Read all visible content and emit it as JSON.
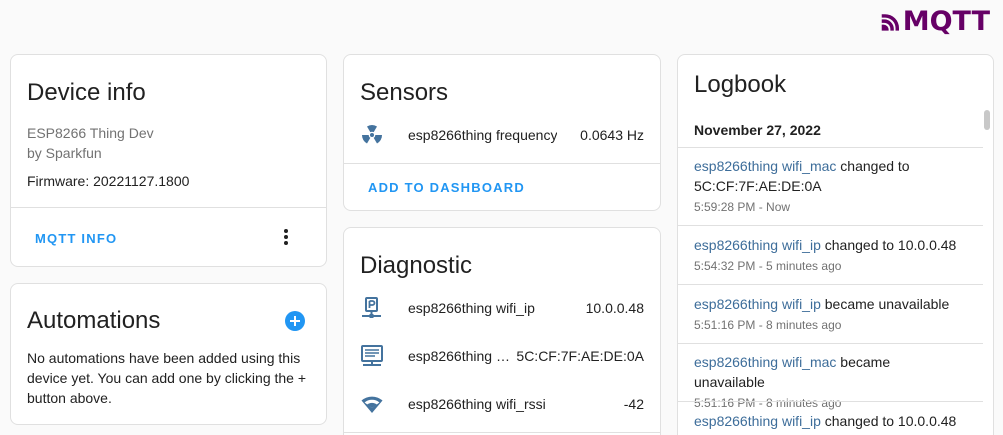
{
  "brand": {
    "logo_text": "MQTT",
    "logo_color": "#660066"
  },
  "device_info": {
    "title": "Device info",
    "model": "ESP8266 Thing Dev",
    "manufacturer": "by Sparkfun",
    "firmware": "Firmware: 20221127.1800",
    "action_label": "MQTT INFO",
    "menu_icon": "more-vert-icon"
  },
  "automations": {
    "title": "Automations",
    "add_icon": "plus-circle-icon",
    "empty_text": "No automations have been added using this device yet. You can add one by clicking the + button above."
  },
  "sensors": {
    "title": "Sensors",
    "items": [
      {
        "icon": "radioactive-icon",
        "name": "esp8266thing frequency",
        "value": "0.0643 Hz"
      }
    ],
    "action_label": "ADD TO DASHBOARD"
  },
  "diagnostic": {
    "title": "Diagnostic",
    "items": [
      {
        "icon": "ip-network-icon",
        "name": "esp8266thing wifi_ip",
        "value": "10.0.0.48"
      },
      {
        "icon": "network-card-icon",
        "name": "esp8266thing w…",
        "value": "5C:CF:7F:AE:DE:0A"
      },
      {
        "icon": "wifi-icon",
        "name": "esp8266thing wifi_rssi",
        "value": "-42"
      }
    ]
  },
  "logbook": {
    "title": "Logbook",
    "date": "November 27, 2022",
    "entries": [
      {
        "entity": "esp8266thing wifi_mac",
        "message": " changed to",
        "message2": "5C:CF:7F:AE:DE:0A",
        "time": "5:59:28 PM - Now"
      },
      {
        "entity": "esp8266thing wifi_ip",
        "message": " changed to 10.0.0.48",
        "time": "5:54:32 PM - 5 minutes ago"
      },
      {
        "entity": "esp8266thing wifi_ip",
        "message": " became unavailable",
        "time": "5:51:16 PM - 8 minutes ago"
      },
      {
        "entity": "esp8266thing wifi_mac",
        "message": " became unavailable",
        "time": "5:51:16 PM - 8 minutes ago"
      },
      {
        "entity": "esp8266thing wifi_ip",
        "message": " changed to 10.0.0.48",
        "time": ""
      }
    ]
  },
  "colors": {
    "accent": "#2196f3",
    "icon": "#44739e",
    "link": "#3d6d9a"
  }
}
